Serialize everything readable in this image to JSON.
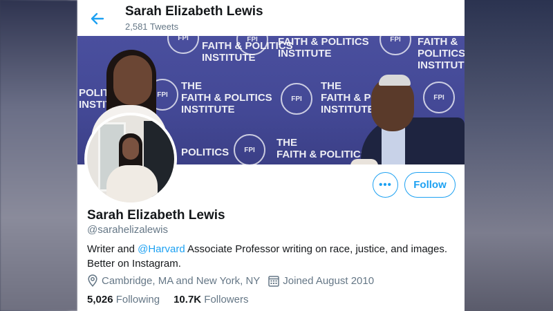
{
  "header": {
    "title": "Sarah Elizabeth Lewis",
    "tweet_count": "2,581 Tweets"
  },
  "banner": {
    "logo_lines": [
      "THE",
      "FAITH & POLITICS",
      "INSTITUTE"
    ],
    "logo_short": "FAITH & POLITICS",
    "logo_short2": "INSTITUTE",
    "logo_mark": "FPI",
    "logo_fragment": "POLITICS",
    "logo_fragment2": "INSTITUTE"
  },
  "actions": {
    "more_label": "•••",
    "follow_label": "Follow"
  },
  "profile": {
    "name": "Sarah Elizabeth Lewis",
    "handle": "@sarahelizalewis",
    "bio_before": "Writer and ",
    "bio_mention": "@Harvard",
    "bio_after": " Associate Professor writing on race, justice, and images. Better on Instagram.",
    "location": "Cambridge, MA and New York, NY",
    "joined": "Joined August 2010",
    "following_count": "5,026",
    "following_label": "Following",
    "followers_count": "10.7K",
    "followers_label": "Followers"
  },
  "icons": {
    "back": "back-arrow-icon",
    "location": "location-pin-icon",
    "calendar": "calendar-icon"
  },
  "colors": {
    "accent": "#1da1f2",
    "text_primary": "#14171a",
    "text_secondary": "#657786",
    "banner": "#4a4f9e"
  }
}
